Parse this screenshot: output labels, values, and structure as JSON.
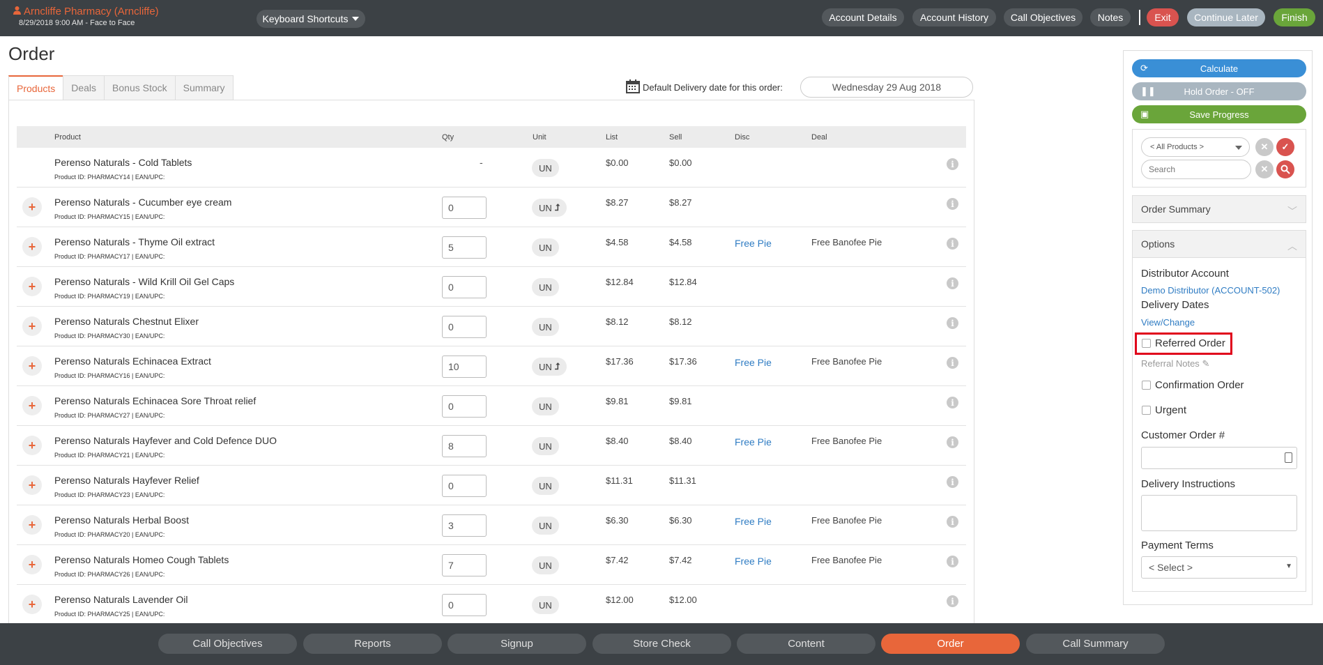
{
  "header": {
    "account_name": "Arncliffe Pharmacy (Arncliffe)",
    "account_sub": "8/29/2018 9:00 AM - Face to Face",
    "keyboard_shortcuts": "Keyboard Shortcuts",
    "account_details": "Account Details",
    "account_history": "Account History",
    "call_objectives": "Call Objectives",
    "notes": "Notes",
    "exit": "Exit",
    "continue_later": "Continue Later",
    "finish": "Finish"
  },
  "page": {
    "title": "Order",
    "tabs": [
      "Products",
      "Deals",
      "Bonus Stock",
      "Summary"
    ],
    "delivery_label": "Default Delivery date for this order:",
    "delivery_date": "Wednesday 29 Aug 2018"
  },
  "table": {
    "columns": [
      "Product",
      "Qty",
      "Unit",
      "List",
      "Sell",
      "Disc",
      "Deal"
    ],
    "rows": [
      {
        "name": "Perenso Naturals - Cold Tablets",
        "pid": "Product ID: PHARMACY14 | EAN/UPC:",
        "qty": "-",
        "unit": "UN",
        "list": "$0.00",
        "sell": "$0.00",
        "disc": "",
        "deal": ""
      },
      {
        "name": "Perenso Naturals - Cucumber eye cream",
        "pid": "Product ID: PHARMACY15 | EAN/UPC:",
        "qty": "0",
        "unit": "UN",
        "list": "$8.27",
        "sell": "$8.27",
        "disc": "",
        "deal": ""
      },
      {
        "name": "Perenso Naturals - Thyme Oil extract",
        "pid": "Product ID: PHARMACY17 | EAN/UPC:",
        "qty": "5",
        "unit": "UN",
        "list": "$4.58",
        "sell": "$4.58",
        "disc": "Free Pie",
        "deal": "Free Banofee Pie"
      },
      {
        "name": "Perenso Naturals - Wild Krill Oil Gel Caps",
        "pid": "Product ID: PHARMACY19 | EAN/UPC:",
        "qty": "0",
        "unit": "UN",
        "list": "$12.84",
        "sell": "$12.84",
        "disc": "",
        "deal": ""
      },
      {
        "name": "Perenso Naturals Chestnut Elixer",
        "pid": "Product ID: PHARMACY30 | EAN/UPC:",
        "qty": "0",
        "unit": "UN",
        "list": "$8.12",
        "sell": "$8.12",
        "disc": "",
        "deal": ""
      },
      {
        "name": "Perenso Naturals Echinacea Extract",
        "pid": "Product ID: PHARMACY16 | EAN/UPC:",
        "qty": "10",
        "unit": "UN",
        "list": "$17.36",
        "sell": "$17.36",
        "disc": "Free Pie",
        "deal": "Free Banofee Pie"
      },
      {
        "name": "Perenso Naturals Echinacea Sore Throat relief",
        "pid": "Product ID: PHARMACY27 | EAN/UPC:",
        "qty": "0",
        "unit": "UN",
        "list": "$9.81",
        "sell": "$9.81",
        "disc": "",
        "deal": ""
      },
      {
        "name": "Perenso Naturals Hayfever and Cold Defence DUO",
        "pid": "Product ID: PHARMACY21 | EAN/UPC:",
        "qty": "8",
        "unit": "UN",
        "list": "$8.40",
        "sell": "$8.40",
        "disc": "Free Pie",
        "deal": "Free Banofee Pie"
      },
      {
        "name": "Perenso Naturals Hayfever Relief",
        "pid": "Product ID: PHARMACY23 | EAN/UPC:",
        "qty": "0",
        "unit": "UN",
        "list": "$11.31",
        "sell": "$11.31",
        "disc": "",
        "deal": ""
      },
      {
        "name": "Perenso Naturals Herbal Boost",
        "pid": "Product ID: PHARMACY20 | EAN/UPC:",
        "qty": "3",
        "unit": "UN",
        "list": "$6.30",
        "sell": "$6.30",
        "disc": "Free Pie",
        "deal": "Free Banofee Pie"
      },
      {
        "name": "Perenso Naturals Homeo Cough Tablets",
        "pid": "Product ID: PHARMACY26 | EAN/UPC:",
        "qty": "7",
        "unit": "UN",
        "list": "$7.42",
        "sell": "$7.42",
        "disc": "Free Pie",
        "deal": "Free Banofee Pie"
      },
      {
        "name": "Perenso Naturals Lavender Oil",
        "pid": "Product ID: PHARMACY25 | EAN/UPC:",
        "qty": "0",
        "unit": "UN",
        "list": "$12.00",
        "sell": "$12.00",
        "disc": "",
        "deal": ""
      }
    ]
  },
  "side": {
    "calculate": "Calculate",
    "hold_order": "Hold Order - OFF",
    "save_progress": "Save Progress",
    "product_filter": "< All Products >",
    "search_placeholder": "Search",
    "order_summary": "Order Summary",
    "options": "Options",
    "distributor_account_label": "Distributor Account",
    "distributor_account_value": "Demo Distributor (ACCOUNT-502)",
    "delivery_dates_label": "Delivery Dates",
    "view_change": "View/Change",
    "referred_order": "Referred Order",
    "referral_notes": "Referral Notes",
    "confirmation_order": "Confirmation Order",
    "urgent": "Urgent",
    "customer_order_label": "Customer Order #",
    "delivery_instructions_label": "Delivery Instructions",
    "payment_terms_label": "Payment Terms",
    "payment_terms_value": "< Select >"
  },
  "bottom_nav": [
    "Call Objectives",
    "Reports",
    "Signup",
    "Store Check",
    "Content",
    "Order",
    "Call Summary"
  ],
  "colors": {
    "accent": "#e8663a",
    "link": "#2f7cc3",
    "calculate": "#3a8fd6",
    "save": "#6aa53a",
    "exit": "#d9534f",
    "finish": "#6aa53a",
    "highlight": "#e0001b"
  }
}
